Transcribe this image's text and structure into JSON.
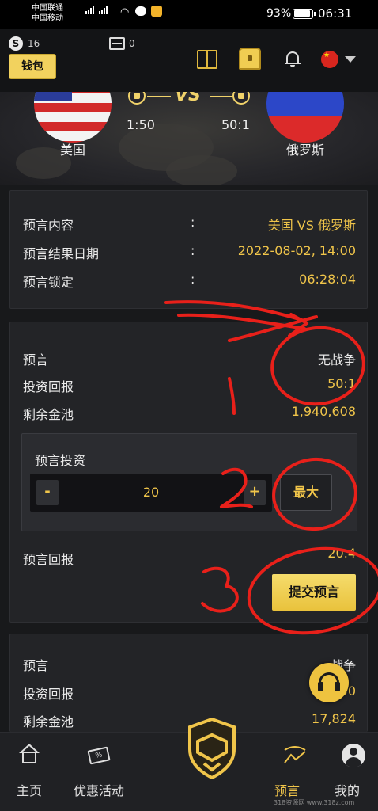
{
  "status_bar": {
    "carrier_1": "中国联通",
    "carrier_2": "中国移动",
    "battery_percent": "93%",
    "time": "06:31"
  },
  "header": {
    "coin_count": "16",
    "wallet_label": "钱包",
    "ticket_count": "0",
    "icons": [
      "coin-icon",
      "ticket-icon",
      "gift-icon",
      "treasure-chest-icon",
      "bell-icon",
      "china-flag-icon",
      "chevron-down-icon"
    ]
  },
  "match": {
    "team_left": "美国",
    "team_right": "俄罗斯",
    "vs": "VS",
    "odds_left": "1:50",
    "odds_right": "50:1"
  },
  "info_panel": {
    "rows": [
      {
        "label": "预言内容",
        "colon": ":",
        "value": "美国 VS 俄罗斯"
      },
      {
        "label": "预言结果日期",
        "colon": ":",
        "value": "2022-08-02, 14:00"
      },
      {
        "label": "预言锁定",
        "colon": ":",
        "value": "06:28:04"
      }
    ]
  },
  "bet_panel": {
    "prediction_label": "预言",
    "prediction_value": "无战争",
    "return_label": "投资回报",
    "return_value": "50:1",
    "pool_label": "剩余金池",
    "pool_value": "1,940,608",
    "invest_title": "预言投资",
    "minus": "-",
    "amount": "20",
    "plus": "+",
    "max_label": "最大",
    "payout_label": "预言回报",
    "payout_value": "20.4",
    "submit_label": "提交预言"
  },
  "bet_panel_2": {
    "prediction_label": "预言",
    "prediction_value": "战争",
    "return_label": "投资回报",
    "return_value": "1:50",
    "pool_label": "剩余金池",
    "pool_value": "17,824"
  },
  "annotations": {
    "numbers": [
      "1",
      "2",
      "3"
    ],
    "color": "#e8201a"
  },
  "bottom_nav": {
    "items": [
      {
        "label": "主页",
        "icon": "home-icon"
      },
      {
        "label": "优惠活动",
        "icon": "coupon-icon"
      },
      {
        "label": "",
        "icon": "shield-logo-icon"
      },
      {
        "label": "预言",
        "icon": "prediction-icon",
        "active": true
      },
      {
        "label": "我的",
        "icon": "profile-icon"
      }
    ]
  },
  "watermark": "318资源网 www.318z.com",
  "colors": {
    "accent": "#f0c54a",
    "background": "#18191b",
    "panel": "#232427"
  }
}
